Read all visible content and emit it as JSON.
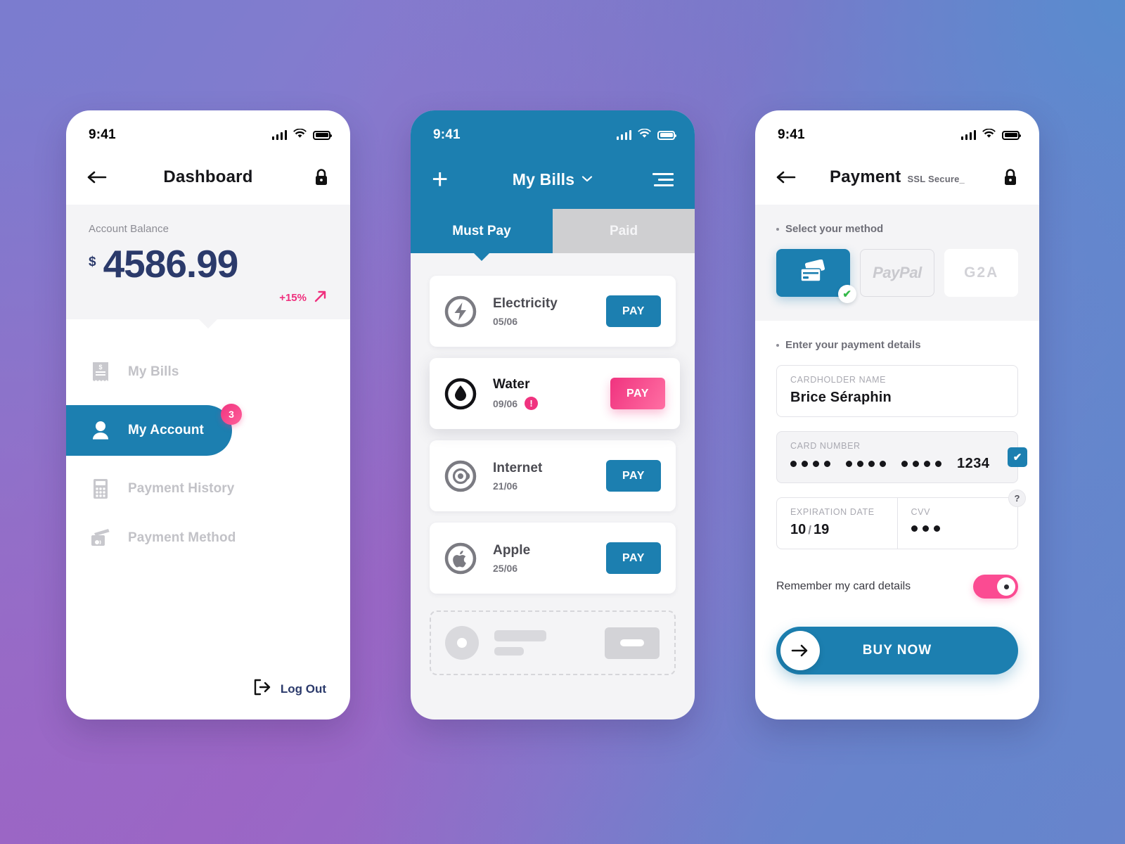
{
  "statusbar": {
    "time": "9:41"
  },
  "dashboard": {
    "nav": {
      "title": "Dashboard",
      "back_icon": "arrow-left-icon",
      "lock_icon": "lock-icon"
    },
    "balance": {
      "label": "Account Balance",
      "currency": "$",
      "value": "4586.99",
      "delta": "+15%",
      "delta_icon": "trend-up-arrow-icon",
      "delta_color": "#ef2f7d"
    },
    "menu": [
      {
        "label": "My Bills",
        "icon": "receipt-icon",
        "active": false,
        "badge": ""
      },
      {
        "label": "My Account",
        "icon": "user-icon",
        "active": true,
        "badge": "3"
      },
      {
        "label": "Payment History",
        "icon": "calculator-icon",
        "active": false,
        "badge": ""
      },
      {
        "label": "Payment Method",
        "icon": "credit-card-icon",
        "active": false,
        "badge": ""
      }
    ],
    "logout": {
      "label": "Log Out",
      "icon": "logout-icon"
    }
  },
  "bills": {
    "nav": {
      "title": "My Bills",
      "add_icon": "plus-icon",
      "menu_icon": "hamburger-icon",
      "chevron_icon": "chevron-down-icon"
    },
    "tabs": [
      {
        "label": "Must Pay",
        "active": true
      },
      {
        "label": "Paid",
        "active": false
      }
    ],
    "items": [
      {
        "name": "Electricity",
        "date": "05/06",
        "icon": "lightning-icon",
        "pay_label": "PAY",
        "urgent": false,
        "highlight": false
      },
      {
        "name": "Water",
        "date": "09/06",
        "icon": "water-drop-icon",
        "pay_label": "PAY",
        "urgent": true,
        "warn_mark": "!",
        "highlight": true
      },
      {
        "name": "Internet",
        "date": "21/06",
        "icon": "at-sign-icon",
        "pay_label": "PAY",
        "urgent": false,
        "highlight": false
      },
      {
        "name": "Apple",
        "date": "25/06",
        "icon": "apple-icon",
        "pay_label": "PAY",
        "urgent": false,
        "highlight": false
      }
    ],
    "colors": {
      "accent": "#1c7fb0",
      "urgent": "#f0337f",
      "tab_inactive": "#cfcfd1"
    }
  },
  "payment": {
    "nav": {
      "title": "Payment",
      "subtitle": "SSL Secure_",
      "back_icon": "arrow-left-icon",
      "lock_icon": "lock-icon"
    },
    "method_section_label": "Select your method",
    "methods": [
      {
        "name": "credit-card",
        "label": "",
        "icon": "cards-icon",
        "selected": true
      },
      {
        "name": "paypal",
        "label": "PayPal",
        "icon": "",
        "selected": false
      },
      {
        "name": "g2a",
        "label": "G2A",
        "icon": "",
        "selected": false
      }
    ],
    "details_section_label": "Enter your payment details",
    "fields": {
      "cardholder": {
        "label": "CARDHOLDER NAME",
        "value": "Brice Séraphin"
      },
      "card_number": {
        "label": "CARD NUMBER",
        "masked_groups": 3,
        "last4": "1234",
        "verified_icon": "check-icon"
      },
      "expiration": {
        "label": "EXPIRATION DATE",
        "month": "10",
        "separator": "/",
        "year": "19"
      },
      "cvv": {
        "label": "CVV",
        "dots": 3,
        "help_icon": "question-mark-icon"
      }
    },
    "remember": {
      "label": "Remember my card details",
      "enabled": true,
      "color": "#fb4b92"
    },
    "buy": {
      "label": "BUY NOW",
      "icon": "arrow-right-icon"
    }
  },
  "theme": {
    "accent_blue": "#1c7fb0",
    "accent_pink": "#f0337f",
    "navy_text": "#2b3a6b",
    "bg_gradient": [
      "#7b7ccd",
      "#9b66c5",
      "#6884cc",
      "#588cce"
    ]
  }
}
